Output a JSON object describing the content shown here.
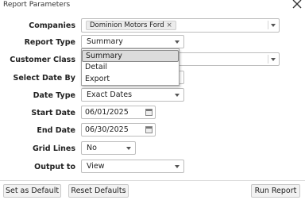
{
  "window": {
    "title": "Report Parameters"
  },
  "labels": {
    "companies": "Companies",
    "report_type": "Report Type",
    "customer_class": "Customer Class",
    "select_date_by": "Select Date By",
    "date_type": "Date Type",
    "start_date": "Start Date",
    "end_date": "End Date",
    "grid_lines": "Grid Lines",
    "output_to": "Output to"
  },
  "fields": {
    "companies_chip": "Dominion Motors Ford",
    "companies_chip_remove": "×",
    "report_type": "Summary",
    "date_type": "Exact Dates",
    "start_date": "06/01/2025",
    "end_date": "06/30/2025",
    "grid_lines": "No",
    "output_to": "View"
  },
  "report_type_dropdown": {
    "options": [
      "Summary",
      "Detail",
      "Export"
    ],
    "selected": "Summary"
  },
  "buttons": {
    "set_default": "Set as Default",
    "reset_defaults": "Reset Defaults",
    "run_report": "Run Report"
  }
}
